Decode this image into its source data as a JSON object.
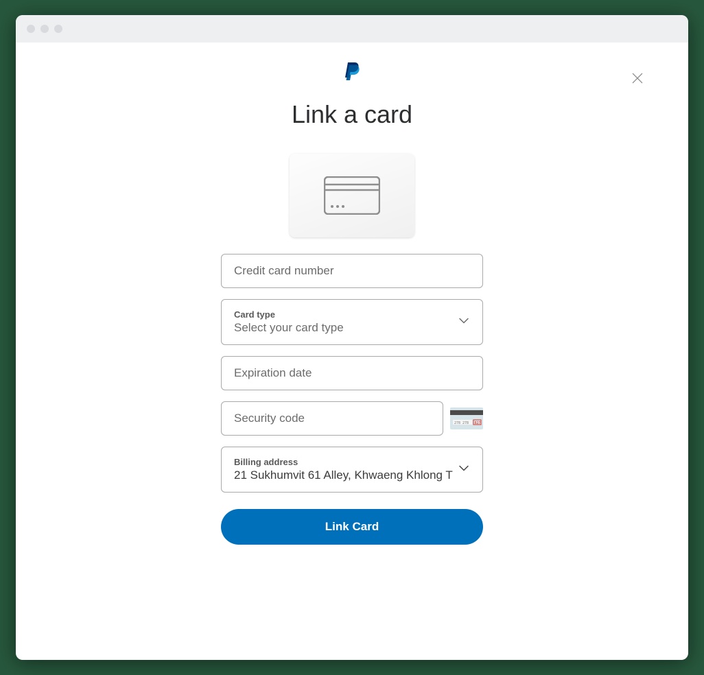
{
  "header": {
    "brand": "PayPal"
  },
  "title": "Link a card",
  "form": {
    "card_number_placeholder": "Credit card number",
    "card_type": {
      "label": "Card type",
      "value": "Select your card type"
    },
    "expiration_placeholder": "Expiration date",
    "security_code_placeholder": "Security code",
    "billing_address": {
      "label": "Billing address",
      "value": "21 Sukhumvit 61 Alley, Khwaeng Khlong T"
    },
    "submit_label": "Link Card"
  }
}
